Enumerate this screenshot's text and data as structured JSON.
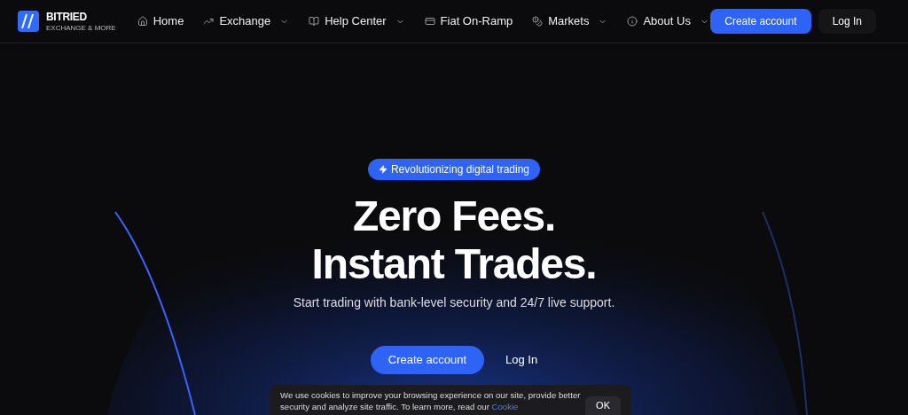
{
  "header": {
    "brand": "BITRIED",
    "tagline": "EXCHANGE & MORE",
    "nav": [
      {
        "label": "Home",
        "dropdown": false
      },
      {
        "label": "Exchange",
        "dropdown": true
      },
      {
        "label": "Help Center",
        "dropdown": true
      },
      {
        "label": "Fiat On-Ramp",
        "dropdown": false
      },
      {
        "label": "Markets",
        "dropdown": true
      },
      {
        "label": "About Us",
        "dropdown": true
      }
    ],
    "create_account": "Create account",
    "log_in": "Log In"
  },
  "hero": {
    "badge": "Revolutionizing digital trading",
    "title_lines": [
      "Zero Fees.",
      "Instant Trades."
    ],
    "subtitle": "Start trading with bank-level security and 24/7 live support.",
    "create_account": "Create account",
    "log_in": "Log In"
  },
  "cookie": {
    "text": "We use cookies to improve your browsing experience on our site, provide better security and analyze site traffic. To learn more, read our",
    "link": "Cookie",
    "ok": "OK"
  }
}
